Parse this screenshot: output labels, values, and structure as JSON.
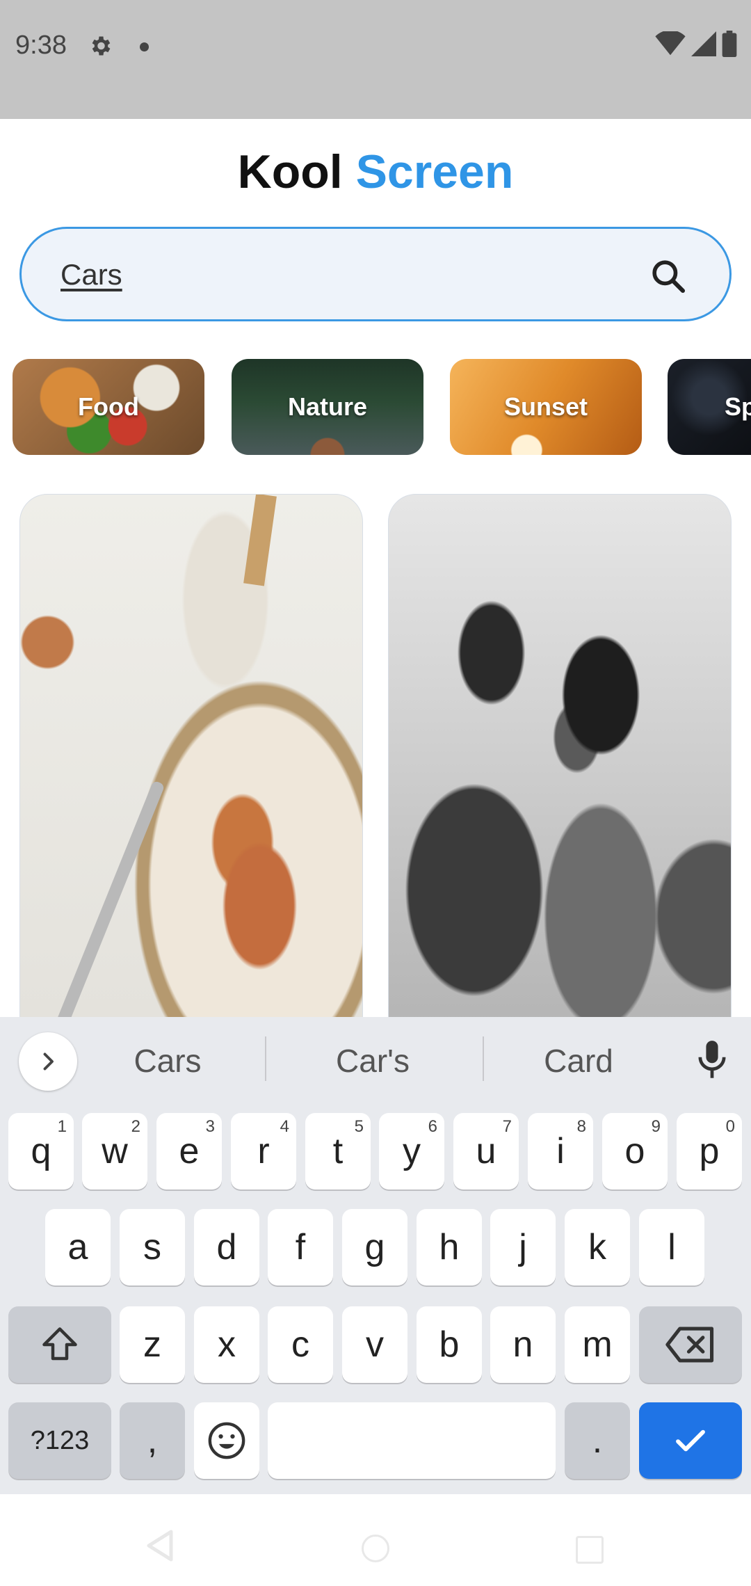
{
  "status_bar": {
    "time": "9:38",
    "icons": [
      "gear-icon",
      "notification-dot-icon",
      "wifi-icon",
      "signal-icon",
      "battery-icon"
    ]
  },
  "app": {
    "title_part1": "Kool",
    "title_part2": "Screen",
    "accent_color": "#2f95e6"
  },
  "search": {
    "value": "Cars",
    "icon": "search-icon"
  },
  "categories": [
    {
      "label": "Food"
    },
    {
      "label": "Nature"
    },
    {
      "label": "Sunset"
    },
    {
      "label": "Sp"
    }
  ],
  "keyboard": {
    "suggestions": [
      "Cars",
      "Car's",
      "Card"
    ],
    "row1": [
      {
        "key": "q",
        "hint": "1"
      },
      {
        "key": "w",
        "hint": "2"
      },
      {
        "key": "e",
        "hint": "3"
      },
      {
        "key": "r",
        "hint": "4"
      },
      {
        "key": "t",
        "hint": "5"
      },
      {
        "key": "y",
        "hint": "6"
      },
      {
        "key": "u",
        "hint": "7"
      },
      {
        "key": "i",
        "hint": "8"
      },
      {
        "key": "o",
        "hint": "9"
      },
      {
        "key": "p",
        "hint": "0"
      }
    ],
    "row2": [
      "a",
      "s",
      "d",
      "f",
      "g",
      "h",
      "j",
      "k",
      "l"
    ],
    "row3": [
      "z",
      "x",
      "c",
      "v",
      "b",
      "n",
      "m"
    ],
    "symbols_label": "?123",
    "comma_label": ",",
    "period_label": ".",
    "action_color": "#1f74e6"
  }
}
